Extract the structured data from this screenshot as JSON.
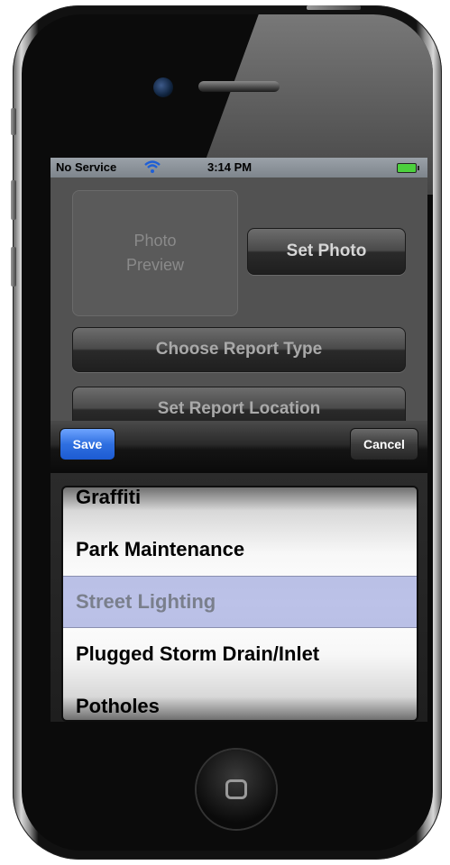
{
  "status_bar": {
    "carrier": "No Service",
    "time": "3:14 PM"
  },
  "form": {
    "photo_preview": "Photo Preview",
    "set_photo_label": "Set Photo",
    "choose_report_type_label": "Choose Report Type",
    "set_report_location_label": "Set Report Location"
  },
  "toolbar": {
    "save_label": "Save",
    "cancel_label": "Cancel"
  },
  "picker": {
    "items": [
      "Graffiti",
      "Park Maintenance",
      "Street Lighting",
      "Plugged Storm Drain/Inlet",
      "Potholes"
    ],
    "selected": "Street Lighting"
  },
  "colors": {
    "save_blue": "#2f6fe0",
    "selection_band": "#5f6ec8",
    "battery_green": "#4cd03d"
  }
}
